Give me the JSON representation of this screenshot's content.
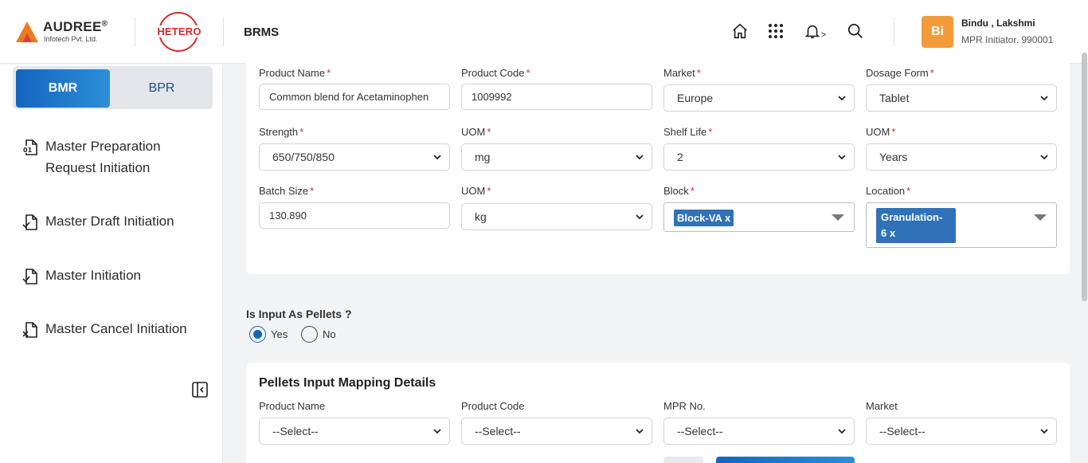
{
  "header": {
    "brand": "AUDREE",
    "brand_mark": "®",
    "brand_sub": "Infotech Pvt. Ltd.",
    "partner": "HETERO",
    "app_name": "BRMS",
    "notif_suffix": ">",
    "user": {
      "initials": "Bi",
      "name": "Bindu , Lakshmi",
      "role": "MPR Initiator. 990001"
    }
  },
  "sidebar": {
    "tabs": {
      "active": "BMR",
      "inactive": "BPR"
    },
    "items": [
      {
        "label_line1": "Master Preparation",
        "label_line2": "Request Initiation",
        "icon": "document-01-icon"
      },
      {
        "label": "Master Draft Initiation",
        "icon": "document-check-icon"
      },
      {
        "label": "Master Initiation",
        "icon": "document-check-icon"
      },
      {
        "label": "Master Cancel Initiation",
        "icon": "document-cancel-icon"
      }
    ]
  },
  "form": {
    "product_name": {
      "label": "Product Name",
      "value": "Common blend for Acetaminophen"
    },
    "product_code": {
      "label": "Product Code",
      "value": "1009992"
    },
    "market": {
      "label": "Market",
      "value": "Europe"
    },
    "dosage_form": {
      "label": "Dosage Form",
      "value": "Tablet"
    },
    "strength": {
      "label": "Strength",
      "value": "650/750/850"
    },
    "uom1": {
      "label": "UOM",
      "value": "mg"
    },
    "shelf_life": {
      "label": "Shelf Life",
      "value": "2"
    },
    "uom2": {
      "label": "UOM",
      "value": "Years"
    },
    "batch_size": {
      "label": "Batch Size",
      "value": "130.890"
    },
    "uom3": {
      "label": "UOM",
      "value": "kg"
    },
    "block": {
      "label": "Block",
      "chip": "Block-VA  x"
    },
    "location": {
      "label": "Location",
      "chip_line1": "Granulation-",
      "chip_line2": "6  x"
    },
    "required_mark": "*"
  },
  "pellets": {
    "question": "Is Input As Pellets ?",
    "yes": "Yes",
    "no": "No",
    "selected": "Yes"
  },
  "mapping": {
    "title": "Pellets Input Mapping Details",
    "product_name": {
      "label": "Product Name",
      "value": "--Select--"
    },
    "product_code": {
      "label": "Product Code",
      "value": "--Select--"
    },
    "mpr_no": {
      "label": "MPR No.",
      "value": "--Select--"
    },
    "market": {
      "label": "Market",
      "value": "--Select--"
    }
  },
  "colors": {
    "accent": "#1565c0",
    "chip": "#2f72b8",
    "avatar": "#f39a3a",
    "hetero": "#d72a2a",
    "required": "#d32f2f"
  }
}
